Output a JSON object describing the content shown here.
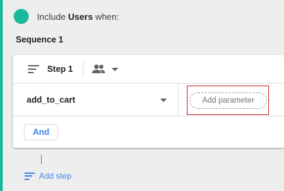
{
  "colors": {
    "accent": "#1ab99b",
    "link_blue": "#4285f4",
    "highlight_red": "#c62828",
    "background": "#eeeeee"
  },
  "include": {
    "prefix": "Include ",
    "target": "Users",
    "suffix": " when:"
  },
  "sequence": {
    "title": "Sequence 1"
  },
  "step": {
    "icon": "lines-icon",
    "label": "Step 1",
    "scope_icon": "people-icon"
  },
  "condition": {
    "event_name": "add_to_cart",
    "add_parameter_label": "Add parameter"
  },
  "and_button_label": "And",
  "add_step_label": "Add step"
}
